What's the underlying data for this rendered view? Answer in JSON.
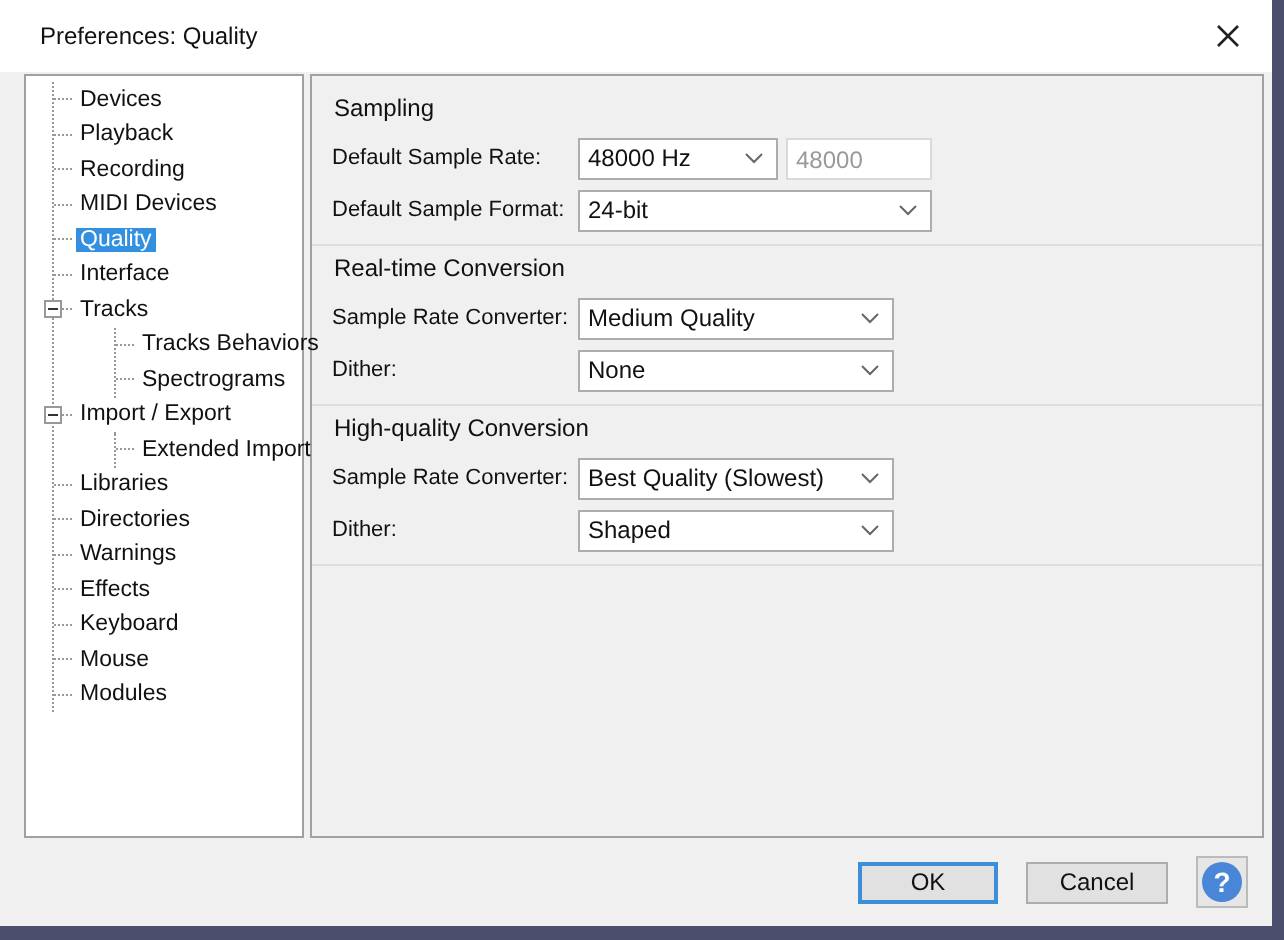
{
  "window": {
    "title": "Preferences: Quality"
  },
  "tree": [
    {
      "label": "Devices",
      "selected": false
    },
    {
      "label": "Playback",
      "selected": false
    },
    {
      "label": "Recording",
      "selected": false
    },
    {
      "label": "MIDI Devices",
      "selected": false
    },
    {
      "label": "Quality",
      "selected": true
    },
    {
      "label": "Interface",
      "selected": false
    },
    {
      "label": "Tracks",
      "selected": false,
      "expanded": true,
      "children": [
        {
          "label": "Tracks Behaviors",
          "selected": false
        },
        {
          "label": "Spectrograms",
          "selected": false
        }
      ]
    },
    {
      "label": "Import / Export",
      "selected": false,
      "expanded": true,
      "children": [
        {
          "label": "Extended Import",
          "selected": false
        }
      ]
    },
    {
      "label": "Libraries",
      "selected": false
    },
    {
      "label": "Directories",
      "selected": false
    },
    {
      "label": "Warnings",
      "selected": false
    },
    {
      "label": "Effects",
      "selected": false
    },
    {
      "label": "Keyboard",
      "selected": false
    },
    {
      "label": "Mouse",
      "selected": false
    },
    {
      "label": "Modules",
      "selected": false
    }
  ],
  "sections": [
    {
      "title": "Sampling",
      "rows": [
        {
          "label": "Default Sample Rate:",
          "kind": "combo-field",
          "value": "48000 Hz",
          "field": {
            "value": "48000",
            "disabled": true
          }
        },
        {
          "label": "Default Sample Format:",
          "kind": "wide-combo",
          "value": "24-bit"
        }
      ]
    },
    {
      "title": "Real-time Conversion",
      "rows": [
        {
          "label": "Sample Rate Converter:",
          "kind": "combo",
          "value": "Medium Quality"
        },
        {
          "label": "Dither:",
          "kind": "combo",
          "value": "None"
        }
      ]
    },
    {
      "title": "High-quality Conversion",
      "rows": [
        {
          "label": "Sample Rate Converter:",
          "kind": "combo",
          "value": "Best Quality (Slowest)"
        },
        {
          "label": "Dither:",
          "kind": "combo",
          "value": "Shaped"
        }
      ]
    }
  ],
  "buttons": [
    {
      "label": "OK",
      "default": true
    },
    {
      "label": "Cancel",
      "default": false
    }
  ],
  "help": "?"
}
